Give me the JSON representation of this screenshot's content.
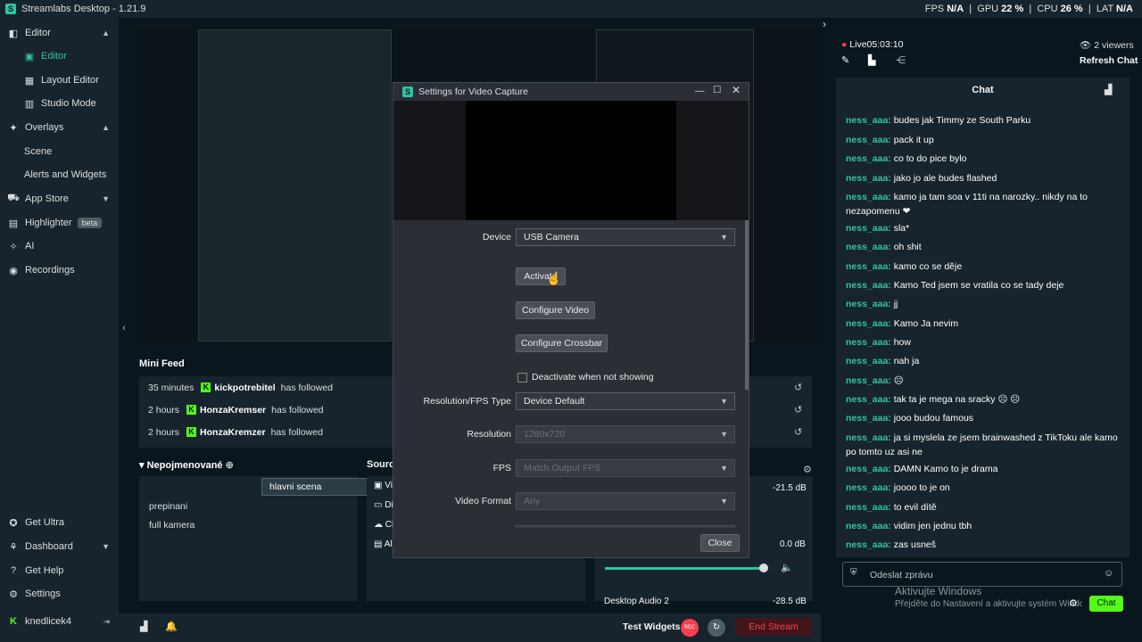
{
  "app": {
    "title": "Streamlabs Desktop - 1.21.9",
    "logo_letter": "S"
  },
  "stats": {
    "fps_label": "FPS",
    "fps_value": "N/A",
    "gpu_label": "GPU",
    "gpu_value": "22 %",
    "cpu_label": "CPU",
    "cpu_value": "26 %",
    "lat_label": "LAT",
    "lat_value": "N/A"
  },
  "sidebar": {
    "items": [
      {
        "label": "Editor",
        "icon": "editor-icon"
      },
      {
        "label": "Editor",
        "icon": "layout-icon"
      },
      {
        "label": "Layout Editor",
        "icon": "grid-icon"
      },
      {
        "label": "Studio Mode",
        "icon": "studio-icon"
      },
      {
        "label": "Overlays",
        "icon": "overlays-icon"
      },
      {
        "label": "Scene"
      },
      {
        "label": "Alerts and Widgets"
      },
      {
        "label": "App Store",
        "icon": "store-icon"
      },
      {
        "label": "Highlighter",
        "icon": "highlighter-icon",
        "badge": "beta"
      },
      {
        "label": "AI",
        "icon": "ai-icon"
      },
      {
        "label": "Recordings",
        "icon": "record-icon"
      }
    ],
    "bottom": [
      {
        "label": "Get Ultra"
      },
      {
        "label": "Dashboard"
      },
      {
        "label": "Get Help"
      },
      {
        "label": "Settings"
      },
      {
        "label": "knedlicek4"
      }
    ]
  },
  "minifeed": {
    "title": "Mini Feed",
    "rows": [
      {
        "time": "35 minutes",
        "user": "kickpotrebitel",
        "action": "has followed"
      },
      {
        "time": "2 hours",
        "user": "HonzaKremser",
        "action": "has followed"
      },
      {
        "time": "2 hours",
        "user": "HonzaKremzer",
        "action": "has followed"
      }
    ]
  },
  "scenes": {
    "title": "Nepojmenované",
    "items": [
      "hlavni scena",
      "prepinani",
      "full kamera"
    ]
  },
  "sources": {
    "title_partial": "Sourc",
    "items": [
      "Vi",
      "Di",
      "Cl",
      "Al"
    ]
  },
  "mixer": {
    "db1": "-21.5 dB",
    "db2": "0.0 dB",
    "next_label": "Desktop Audio 2",
    "db3": "-28.5 dB"
  },
  "bottombar": {
    "test_widgets": "Test Widgets",
    "rec": "REC",
    "end_stream": "End Stream"
  },
  "chat": {
    "live_label": "Live",
    "live_time": "05:03:10",
    "viewers": "2 viewers",
    "refresh": "Refresh Chat",
    "header": "Chat",
    "messages": [
      {
        "user": "ness_aaa:",
        "text": "budes jak Timmy ze South Parku"
      },
      {
        "user": "ness_aaa:",
        "text": "pack it up"
      },
      {
        "user": "ness_aaa:",
        "text": "co to do pice bylo"
      },
      {
        "user": "ness_aaa:",
        "text": "jako jo ale budes flashed"
      },
      {
        "user": "ness_aaa:",
        "text": "kamo ja tam soa v 11ti na narozky.. nikdy na to nezapomenu ❤"
      },
      {
        "user": "ness_aaa:",
        "text": "sla*"
      },
      {
        "user": "ness_aaa:",
        "text": "oh shit"
      },
      {
        "user": "ness_aaa:",
        "text": "kamo co se děje"
      },
      {
        "user": "ness_aaa:",
        "text": "Kamo Ted jsem se vratila co se tady deje"
      },
      {
        "user": "ness_aaa:",
        "text": "jj"
      },
      {
        "user": "ness_aaa:",
        "text": "Kamo Ja nevim"
      },
      {
        "user": "ness_aaa:",
        "text": "how"
      },
      {
        "user": "ness_aaa:",
        "text": "nah ja"
      },
      {
        "user": "ness_aaa:",
        "text": "☹"
      },
      {
        "user": "ness_aaa:",
        "text": "tak ta je mega na sracky ☹ ☹"
      },
      {
        "user": "ness_aaa:",
        "text": "jooo budou famous"
      },
      {
        "user": "ness_aaa:",
        "text": "ja si myslela ze jsem brainwashed z TikToku ale kamo po tomto uz asi ne"
      },
      {
        "user": "ness_aaa:",
        "text": "DAMN Kamo to je drama"
      },
      {
        "user": "ness_aaa:",
        "text": "joooo to je on"
      },
      {
        "user": "ness_aaa:",
        "text": "to evil dítě"
      },
      {
        "user": "ness_aaa:",
        "text": "vidim jen jednu tbh"
      },
      {
        "user": "ness_aaa:",
        "text": "zas usneš"
      }
    ],
    "input_placeholder": "Odeslat zprávu",
    "send_button": "Chat"
  },
  "watermark": {
    "line1": "Aktivujte Windows",
    "line2": "Přejděte do Nastavení a aktivujte systém Windows."
  },
  "dialog": {
    "title": "Settings for Video Capture",
    "device_label": "Device",
    "device_value": "USB Camera",
    "activate": "Activate",
    "configure_video": "Configure Video",
    "configure_crossbar": "Configure Crossbar",
    "deactivate_label": "Deactivate when not showing",
    "res_type_label": "Resolution/FPS Type",
    "res_type_value": "Device Default",
    "resolution_label": "Resolution",
    "resolution_value": "1280x720",
    "fps_label": "FPS",
    "fps_value": "Match Output FPS",
    "video_format_label": "Video Format",
    "video_format_value": "Any",
    "close": "Close"
  }
}
